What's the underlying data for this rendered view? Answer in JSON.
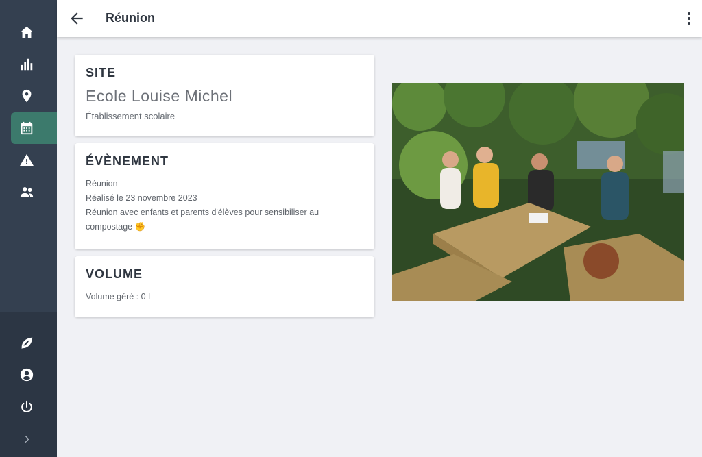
{
  "header": {
    "title": "Réunion",
    "back_icon": "arrow-left-icon",
    "more_icon": "more-vertical-icon"
  },
  "sidebar": {
    "top_items": [
      {
        "name": "home",
        "icon": "home-icon",
        "active": false
      },
      {
        "name": "stats",
        "icon": "bar-chart-icon",
        "active": false
      },
      {
        "name": "sites",
        "icon": "map-pin-icon",
        "active": false
      },
      {
        "name": "events",
        "icon": "calendar-icon",
        "active": true
      },
      {
        "name": "alerts",
        "icon": "warning-icon",
        "active": false
      },
      {
        "name": "users",
        "icon": "users-icon",
        "active": false
      }
    ],
    "bottom_items": [
      {
        "name": "leaf",
        "icon": "leaf-icon"
      },
      {
        "name": "account",
        "icon": "account-circle-icon"
      },
      {
        "name": "logout",
        "icon": "power-icon"
      },
      {
        "name": "expand",
        "icon": "chevron-right-icon"
      }
    ],
    "active_color": "#3c7a6c"
  },
  "site_card": {
    "heading": "SITE",
    "name": "Ecole Louise Michel",
    "type": "Établissement scolaire"
  },
  "event_card": {
    "heading": "ÉVÈNEMENT",
    "kind": "Réunion",
    "date": "Réalisé le 23 novembre 2023",
    "description": "Réunion avec enfants et parents d'élèves pour sensibiliser au compostage ✊"
  },
  "volume_card": {
    "heading": "VOLUME",
    "text": "Volume géré : 0 L"
  }
}
